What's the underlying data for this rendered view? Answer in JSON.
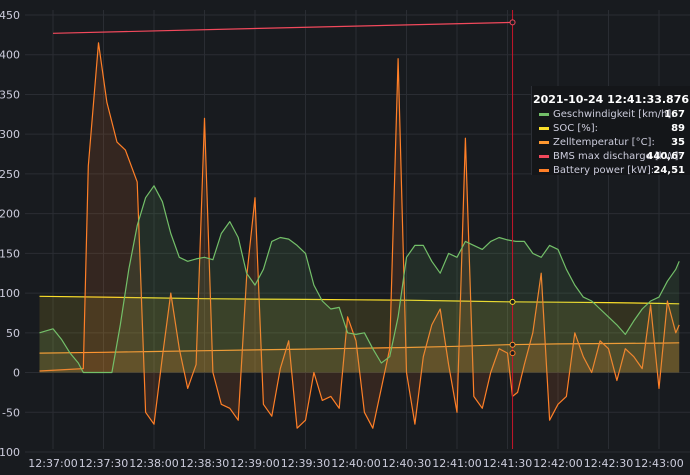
{
  "chart_data": {
    "type": "line",
    "x_ticks": [
      "12:37:00",
      "12:37:30",
      "12:38:00",
      "12:38:30",
      "12:39:00",
      "12:39:30",
      "12:40:00",
      "12:40:30",
      "12:41:00",
      "12:41:30",
      "12:42:00",
      "12:42:30",
      "12:43:00"
    ],
    "xlim": [
      "12:36:52",
      "12:43:12"
    ],
    "y_ticks": [
      450,
      400,
      350,
      300,
      250,
      200,
      150,
      100,
      50,
      0,
      -50,
      -100
    ],
    "ylim": [
      -110,
      460
    ],
    "grid": true,
    "cursor_time": "12:41:33.876",
    "series": [
      {
        "name": "Geschwindigkeit [km/h]",
        "color": "#73bf69",
        "fill": true,
        "points": [
          [
            "12:36:52",
            50
          ],
          [
            "12:37:00",
            55
          ],
          [
            "12:37:05",
            42
          ],
          [
            "12:37:10",
            25
          ],
          [
            "12:37:15",
            12
          ],
          [
            "12:37:18",
            0
          ],
          [
            "12:37:35",
            0
          ],
          [
            "12:37:40",
            60
          ],
          [
            "12:37:45",
            130
          ],
          [
            "12:37:50",
            185
          ],
          [
            "12:37:55",
            220
          ],
          [
            "12:38:00",
            235
          ],
          [
            "12:38:05",
            215
          ],
          [
            "12:38:10",
            175
          ],
          [
            "12:38:15",
            145
          ],
          [
            "12:38:20",
            140
          ],
          [
            "12:38:25",
            143
          ],
          [
            "12:38:30",
            145
          ],
          [
            "12:38:35",
            142
          ],
          [
            "12:38:40",
            175
          ],
          [
            "12:38:45",
            190
          ],
          [
            "12:38:50",
            170
          ],
          [
            "12:38:55",
            125
          ],
          [
            "12:39:00",
            110
          ],
          [
            "12:39:05",
            130
          ],
          [
            "12:39:10",
            165
          ],
          [
            "12:39:15",
            170
          ],
          [
            "12:39:20",
            168
          ],
          [
            "12:39:25",
            160
          ],
          [
            "12:39:30",
            150
          ],
          [
            "12:39:35",
            110
          ],
          [
            "12:39:40",
            90
          ],
          [
            "12:39:45",
            80
          ],
          [
            "12:39:50",
            82
          ],
          [
            "12:39:55",
            50
          ],
          [
            "12:40:00",
            48
          ],
          [
            "12:40:05",
            50
          ],
          [
            "12:40:10",
            30
          ],
          [
            "12:40:15",
            12
          ],
          [
            "12:40:20",
            20
          ],
          [
            "12:40:25",
            70
          ],
          [
            "12:40:30",
            145
          ],
          [
            "12:40:35",
            160
          ],
          [
            "12:40:40",
            160
          ],
          [
            "12:40:45",
            140
          ],
          [
            "12:40:50",
            125
          ],
          [
            "12:40:55",
            150
          ],
          [
            "12:41:00",
            145
          ],
          [
            "12:41:05",
            165
          ],
          [
            "12:41:10",
            160
          ],
          [
            "12:41:15",
            155
          ],
          [
            "12:41:20",
            165
          ],
          [
            "12:41:25",
            170
          ],
          [
            "12:41:30",
            167
          ],
          [
            "12:41:35",
            165
          ],
          [
            "12:41:40",
            165
          ],
          [
            "12:41:45",
            150
          ],
          [
            "12:41:50",
            145
          ],
          [
            "12:41:55",
            160
          ],
          [
            "12:42:00",
            155
          ],
          [
            "12:42:05",
            130
          ],
          [
            "12:42:10",
            110
          ],
          [
            "12:42:15",
            95
          ],
          [
            "12:42:20",
            90
          ],
          [
            "12:42:25",
            80
          ],
          [
            "12:42:30",
            70
          ],
          [
            "12:42:35",
            60
          ],
          [
            "12:42:40",
            48
          ],
          [
            "12:42:45",
            65
          ],
          [
            "12:42:50",
            80
          ],
          [
            "12:42:55",
            90
          ],
          [
            "12:43:00",
            95
          ],
          [
            "12:43:05",
            115
          ],
          [
            "12:43:10",
            130
          ],
          [
            "12:43:12",
            140
          ]
        ]
      },
      {
        "name": "SOC [%]",
        "color": "#fade2a",
        "fill": true,
        "points": [
          [
            "12:36:52",
            96
          ],
          [
            "12:37:30",
            95
          ],
          [
            "12:38:00",
            94
          ],
          [
            "12:38:30",
            93
          ],
          [
            "12:39:00",
            92.5
          ],
          [
            "12:39:30",
            92
          ],
          [
            "12:40:00",
            91.5
          ],
          [
            "12:40:30",
            91
          ],
          [
            "12:41:00",
            90
          ],
          [
            "12:41:30",
            89
          ],
          [
            "12:42:00",
            88.5
          ],
          [
            "12:42:30",
            88
          ],
          [
            "12:43:00",
            87
          ],
          [
            "12:43:12",
            86.5
          ]
        ]
      },
      {
        "name": "Zelltemperatur [°C]",
        "color": "#ff9830",
        "fill": true,
        "points": [
          [
            "12:36:52",
            24.5
          ],
          [
            "12:37:30",
            25.5
          ],
          [
            "12:38:00",
            26.5
          ],
          [
            "12:38:30",
            27.5
          ],
          [
            "12:39:00",
            28.5
          ],
          [
            "12:39:30",
            29.5
          ],
          [
            "12:40:00",
            30.5
          ],
          [
            "12:40:30",
            31.5
          ],
          [
            "12:41:00",
            33
          ],
          [
            "12:41:30",
            35
          ],
          [
            "12:42:00",
            36
          ],
          [
            "12:42:30",
            36.5
          ],
          [
            "12:43:00",
            37
          ],
          [
            "12:43:12",
            37.5
          ]
        ]
      },
      {
        "name": "BMS max discharge [kW]",
        "color": "#f2495c",
        "fill": false,
        "points": [
          [
            "12:37:00",
            427
          ],
          [
            "12:41:33",
            440.67
          ]
        ]
      },
      {
        "name": "Battery power [kW]",
        "color": "#ff7f27",
        "fill": true,
        "points": [
          [
            "12:36:52",
            2
          ],
          [
            "12:37:18",
            5
          ],
          [
            "12:37:21",
            260
          ],
          [
            "12:37:27",
            415
          ],
          [
            "12:37:32",
            340
          ],
          [
            "12:37:38",
            290
          ],
          [
            "12:37:43",
            280
          ],
          [
            "12:37:50",
            240
          ],
          [
            "12:37:55",
            -50
          ],
          [
            "12:38:00",
            -65
          ],
          [
            "12:38:05",
            20
          ],
          [
            "12:38:10",
            100
          ],
          [
            "12:38:15",
            30
          ],
          [
            "12:38:20",
            -20
          ],
          [
            "12:38:25",
            10
          ],
          [
            "12:38:30",
            320
          ],
          [
            "12:38:35",
            0
          ],
          [
            "12:38:40",
            -40
          ],
          [
            "12:38:45",
            -45
          ],
          [
            "12:38:50",
            -60
          ],
          [
            "12:38:55",
            120
          ],
          [
            "12:39:00",
            220
          ],
          [
            "12:39:05",
            -40
          ],
          [
            "12:39:10",
            -55
          ],
          [
            "12:39:15",
            5
          ],
          [
            "12:39:20",
            40
          ],
          [
            "12:39:25",
            -70
          ],
          [
            "12:39:30",
            -60
          ],
          [
            "12:39:35",
            0
          ],
          [
            "12:39:40",
            -35
          ],
          [
            "12:39:45",
            -30
          ],
          [
            "12:39:50",
            -45
          ],
          [
            "12:39:55",
            70
          ],
          [
            "12:40:00",
            40
          ],
          [
            "12:40:05",
            -50
          ],
          [
            "12:40:10",
            -70
          ],
          [
            "12:40:15",
            -20
          ],
          [
            "12:40:20",
            30
          ],
          [
            "12:40:25",
            395
          ],
          [
            "12:40:30",
            0
          ],
          [
            "12:40:35",
            -65
          ],
          [
            "12:40:40",
            20
          ],
          [
            "12:40:45",
            60
          ],
          [
            "12:40:50",
            80
          ],
          [
            "12:40:55",
            10
          ],
          [
            "12:41:00",
            -50
          ],
          [
            "12:41:05",
            295
          ],
          [
            "12:41:10",
            -30
          ],
          [
            "12:41:15",
            -45
          ],
          [
            "12:41:20",
            0
          ],
          [
            "12:41:25",
            30
          ],
          [
            "12:41:30",
            24.51
          ],
          [
            "12:41:33",
            -30
          ],
          [
            "12:41:36",
            -25
          ],
          [
            "12:41:40",
            10
          ],
          [
            "12:41:45",
            50
          ],
          [
            "12:41:50",
            125
          ],
          [
            "12:41:55",
            -60
          ],
          [
            "12:42:00",
            -40
          ],
          [
            "12:42:05",
            -30
          ],
          [
            "12:42:10",
            50
          ],
          [
            "12:42:15",
            20
          ],
          [
            "12:42:20",
            0
          ],
          [
            "12:42:25",
            40
          ],
          [
            "12:42:30",
            30
          ],
          [
            "12:42:35",
            -10
          ],
          [
            "12:42:40",
            30
          ],
          [
            "12:42:45",
            20
          ],
          [
            "12:42:50",
            5
          ],
          [
            "12:42:55",
            85
          ],
          [
            "12:43:00",
            -20
          ],
          [
            "12:43:05",
            90
          ],
          [
            "12:43:10",
            50
          ],
          [
            "12:43:12",
            60
          ]
        ]
      }
    ]
  },
  "tooltip": {
    "time": "2021-10-24 12:41:33.876",
    "rows": [
      {
        "label": "Geschwindigkeit [km/h]:",
        "value": "167",
        "color": "#73bf69"
      },
      {
        "label": "SOC [%]:",
        "value": "89",
        "color": "#fade2a"
      },
      {
        "label": "Zelltemperatur [°C]:",
        "value": "35",
        "color": "#ff9830"
      },
      {
        "label": "BMS max discharge [kW]:",
        "value": "440,67",
        "color": "#f2495c"
      },
      {
        "label": "Battery power [kW]:",
        "value": "24,51",
        "color": "#ff7f27"
      }
    ]
  }
}
